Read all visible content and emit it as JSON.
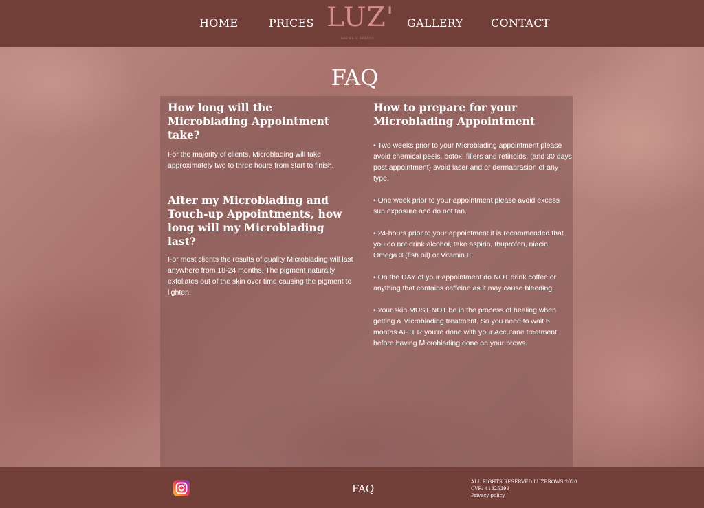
{
  "nav": {
    "home": "HOME",
    "prices": "PRICES",
    "gallery": "GALLERY",
    "contact": "CONTACT"
  },
  "logo": {
    "text": "LUZ'",
    "tagline": "BROWS & BEAUTY"
  },
  "page": {
    "title": "FAQ"
  },
  "faq": {
    "q1": {
      "question": "How long will the Microblading Appointment take?",
      "answer": "For the majority of clients, Microblading will take approximately two to three hours from start to finish."
    },
    "q2": {
      "question": "After my Microblading and Touch-up Appointments, how long will my Microblading last?",
      "answer": "For most clients the results of quality Microblading will last anywhere from 18-24 months. The pigment naturally exfoliates out of the skin over time causing the pigment to lighten."
    },
    "q3": {
      "question": "How to prepare for your Microblading Appointment",
      "tips": [
        "• Two weeks prior to your Microblading appointment please avoid chemical peels, botox, fillers and retinoids, (and 30 days post appointment) avoid laser and or dermabrasion of any type.",
        "• One week prior to your appointment please avoid excess sun exposure and do not tan.",
        "• 24-hours prior to your appointment it is recommended that you do not drink alcohol, take aspirin, Ibuprofen, niacin, Omega 3 (fish oil) or Vitamin E.",
        "• On the DAY of your appointment do NOT drink coffee or anything that contains caffeine as it may cause bleeding.",
        "• Your skin MUST NOT be in the process of healing when getting a Microblading treatment. So you need to wait 6 months AFTER you're done with your Accutane treatment before having Microblading done on your brows."
      ]
    }
  },
  "footer": {
    "faq_link": "FAQ",
    "rights": "ALL RIGHTS RESERVED LUZBROWS 2020",
    "cvr": "CVR: 41325399",
    "privacy": "Privacy policy",
    "social_icon": "instagram-icon"
  },
  "colors": {
    "header_bg": "#713e38",
    "footer_bg": "#713e38",
    "logo": "#d58b8f",
    "panel": "#805654"
  }
}
